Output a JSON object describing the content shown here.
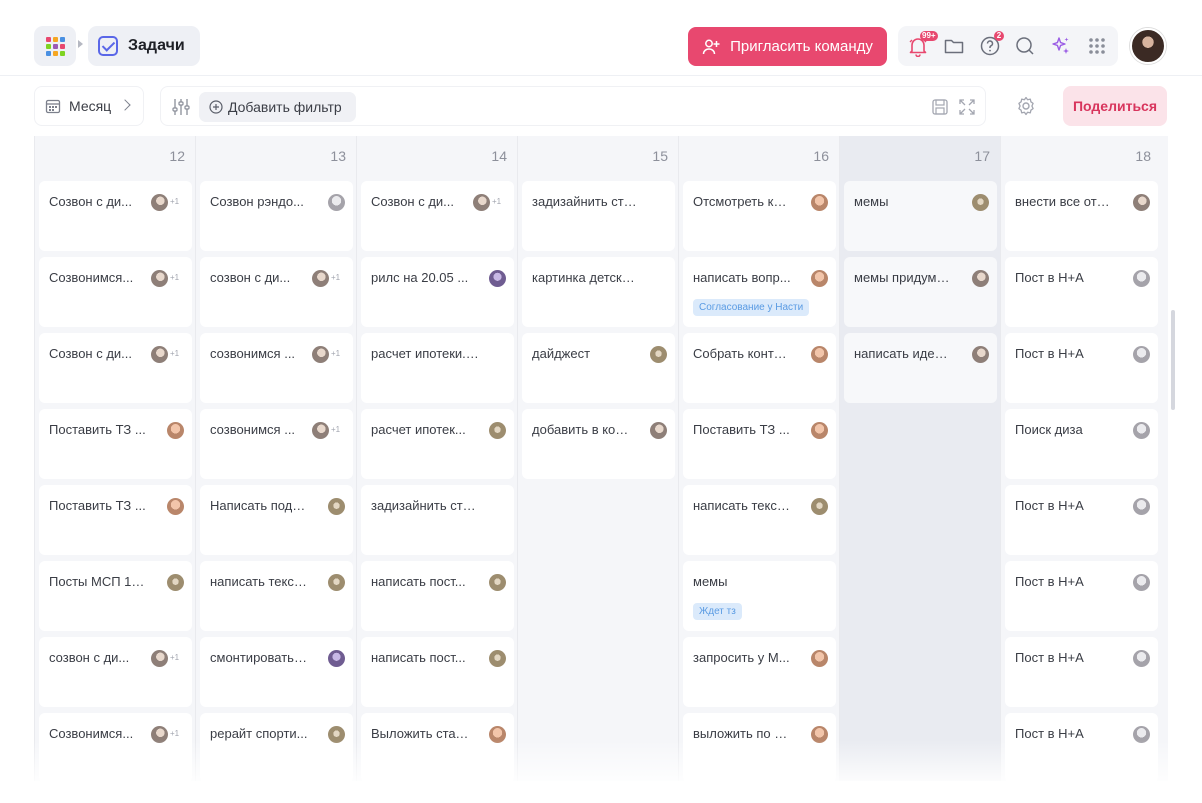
{
  "header": {
    "title": "Задачи",
    "invite_label": "Пригласить команду",
    "notifications_badge": "99+",
    "help_badge": "2",
    "app_colors": [
      "#e8486f",
      "#f5a623",
      "#4a90e2",
      "#7ed321",
      "#9b59b6",
      "#e8486f",
      "#4a90e2",
      "#f5a623",
      "#7ed321"
    ]
  },
  "toolbar": {
    "period_label": "Месяц",
    "add_filter_label": "Добавить фильтр",
    "share_label": "Поделиться"
  },
  "calendar": {
    "days": [
      {
        "day": "12",
        "weekend": false,
        "tasks": [
          {
            "title": "Созвон с ди...",
            "avatar": "a1",
            "plus": "+1"
          },
          {
            "title": "Созвонимся...",
            "avatar": "a1",
            "plus": "+1"
          },
          {
            "title": "Созвон с ди...",
            "avatar": "a1",
            "plus": "+1"
          },
          {
            "title": "Поставить ТЗ ...",
            "avatar": "a2"
          },
          {
            "title": "Поставить ТЗ ...",
            "avatar": "a2"
          },
          {
            "title": "Посты МСП 12...",
            "avatar": "a3"
          },
          {
            "title": "созвон с ди...",
            "avatar": "a1",
            "plus": "+1"
          },
          {
            "title": "Созвонимся...",
            "avatar": "a1",
            "plus": "+1"
          }
        ]
      },
      {
        "day": "13",
        "weekend": false,
        "tasks": [
          {
            "title": "Созвон рэндо...",
            "avatar": "a5"
          },
          {
            "title": "созвон с ди...",
            "avatar": "a1",
            "plus": "+1"
          },
          {
            "title": "созвонимся ...",
            "avatar": "a1",
            "plus": "+1"
          },
          {
            "title": "созвонимся ...",
            "avatar": "a1",
            "plus": "+1"
          },
          {
            "title": "Написать подв...",
            "avatar": "a3"
          },
          {
            "title": "написать текст...",
            "avatar": "a3"
          },
          {
            "title": "смонтировать ...",
            "avatar": "a4"
          },
          {
            "title": "рерайт спорти...",
            "avatar": "a3"
          }
        ]
      },
      {
        "day": "14",
        "weekend": false,
        "tasks": [
          {
            "title": "Созвон с ди...",
            "avatar": "a1",
            "plus": "+1"
          },
          {
            "title": "рилс на 20.05 ...",
            "avatar": "a4"
          },
          {
            "title": "расчет ипотеки. к..."
          },
          {
            "title": "расчет ипотек...",
            "avatar": "a3"
          },
          {
            "title": "задизайнить стор..."
          },
          {
            "title": "написать пост...",
            "avatar": "a3"
          },
          {
            "title": "написать пост...",
            "avatar": "a3"
          },
          {
            "title": "Выложить стат...",
            "avatar": "a2"
          }
        ]
      },
      {
        "day": "15",
        "weekend": false,
        "tasks": [
          {
            "title": "задизайнить стор..."
          },
          {
            "title": "картинка детских ..."
          },
          {
            "title": "дайджест",
            "avatar": "a3"
          },
          {
            "title": "добавить в кон...",
            "avatar": "a1"
          }
        ]
      },
      {
        "day": "16",
        "weekend": false,
        "tasks": [
          {
            "title": "Отсмотреть ко...",
            "avatar": "a2"
          },
          {
            "title": "написать вопр...",
            "avatar": "a2",
            "tag": "Согласование у Насти"
          },
          {
            "title": "Собрать конте...",
            "avatar": "a2"
          },
          {
            "title": "Поставить ТЗ ...",
            "avatar": "a2"
          },
          {
            "title": "написать текст...",
            "avatar": "a3"
          },
          {
            "title": "мемы",
            "tag": "Ждет тз"
          },
          {
            "title": "запросить у М...",
            "avatar": "a2"
          },
          {
            "title": "выложить по 3...",
            "avatar": "a2"
          }
        ]
      },
      {
        "day": "17",
        "weekend": true,
        "tasks": [
          {
            "title": "мемы",
            "avatar": "a3"
          },
          {
            "title": "мемы придума...",
            "avatar": "a1"
          },
          {
            "title": "написать идеи...",
            "avatar": "a1"
          }
        ]
      },
      {
        "day": "18",
        "weekend": false,
        "tasks": [
          {
            "title": "внести все отп...",
            "avatar": "a1"
          },
          {
            "title": "Пост в Н+А",
            "avatar": "a5"
          },
          {
            "title": "Пост в Н+А",
            "avatar": "a5"
          },
          {
            "title": "Поиск диза",
            "avatar": "a5"
          },
          {
            "title": "Пост в Н+А",
            "avatar": "a5"
          },
          {
            "title": "Пост в Н+А",
            "avatar": "a5"
          },
          {
            "title": "Пост в Н+А",
            "avatar": "a5"
          },
          {
            "title": "Пост в Н+А",
            "avatar": "a5"
          }
        ]
      }
    ]
  }
}
